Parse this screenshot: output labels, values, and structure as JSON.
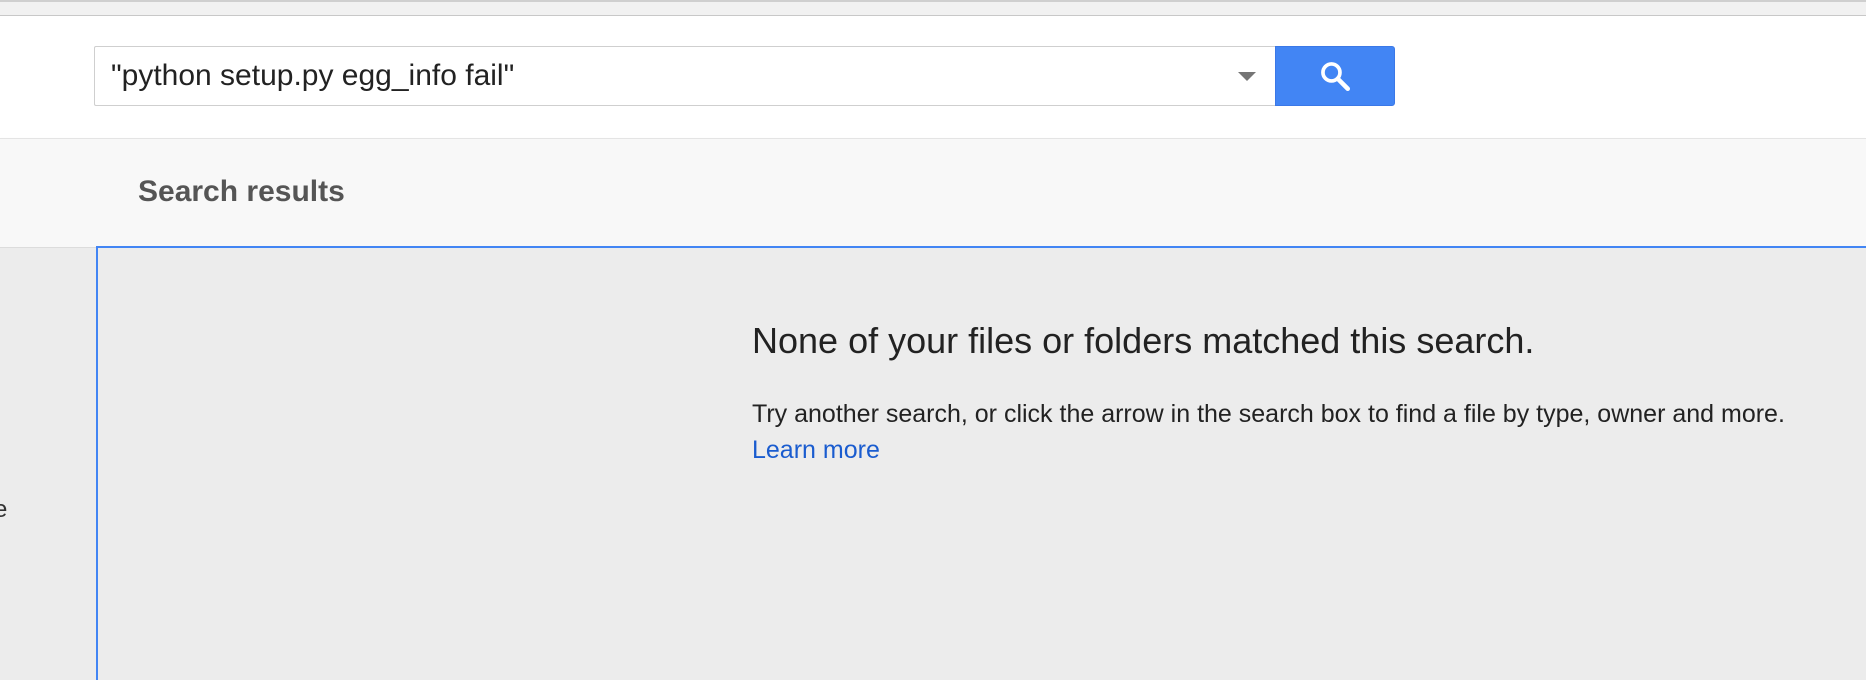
{
  "search": {
    "value": "\"python setup.py egg_info fail\"",
    "options_icon": "chevron-down-icon",
    "button_icon": "search-icon"
  },
  "subheader": {
    "title": "Search results"
  },
  "left_rail": {
    "partial_text": "e"
  },
  "empty_state": {
    "heading": "None of your files or folders matched this search.",
    "message": "Try another search, or click the arrow in the search box to find a file by type, owner and more.",
    "learn_more": "Learn more"
  },
  "colors": {
    "accent": "#4285f4",
    "link": "#1a5ccf",
    "content_bg": "#ececec"
  }
}
